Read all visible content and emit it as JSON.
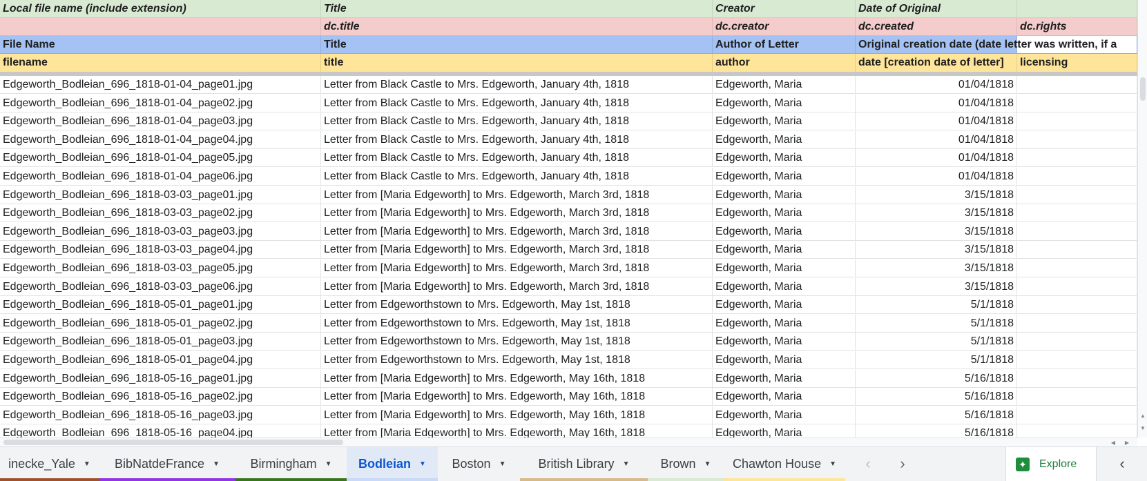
{
  "sheet": {
    "header_rows": {
      "label_row": [
        "Local file name (include extension)",
        "Title",
        "Creator",
        "Date of Original",
        ""
      ],
      "dc_row": [
        "",
        "dc.title",
        "dc.creator",
        "dc.created",
        "dc.rights"
      ],
      "display_row": [
        "File Name",
        "Title",
        "Author of Letter",
        "Original creation date (date letter was written, if a",
        ""
      ],
      "field_row": [
        "filename",
        "title",
        "author",
        "date [creation date of letter]",
        "licensing"
      ]
    },
    "rows": [
      [
        "Edgeworth_Bodleian_696_1818-01-04_page01.jpg",
        "Letter from Black Castle to Mrs. Edgeworth, January 4th, 1818",
        "Edgeworth, Maria",
        "01/04/1818",
        ""
      ],
      [
        "Edgeworth_Bodleian_696_1818-01-04_page02.jpg",
        "Letter from Black Castle to Mrs. Edgeworth, January 4th, 1818",
        "Edgeworth, Maria",
        "01/04/1818",
        ""
      ],
      [
        "Edgeworth_Bodleian_696_1818-01-04_page03.jpg",
        "Letter from Black Castle to Mrs. Edgeworth, January 4th, 1818",
        "Edgeworth, Maria",
        "01/04/1818",
        ""
      ],
      [
        "Edgeworth_Bodleian_696_1818-01-04_page04.jpg",
        "Letter from Black Castle to Mrs. Edgeworth, January 4th, 1818",
        "Edgeworth, Maria",
        "01/04/1818",
        ""
      ],
      [
        "Edgeworth_Bodleian_696_1818-01-04_page05.jpg",
        "Letter from Black Castle to Mrs. Edgeworth, January 4th, 1818",
        "Edgeworth, Maria",
        "01/04/1818",
        ""
      ],
      [
        "Edgeworth_Bodleian_696_1818-01-04_page06.jpg",
        "Letter from Black Castle to Mrs. Edgeworth, January 4th, 1818",
        "Edgeworth, Maria",
        "01/04/1818",
        ""
      ],
      [
        "Edgeworth_Bodleian_696_1818-03-03_page01.jpg",
        "Letter from [Maria Edgeworth] to Mrs. Edgeworth, March 3rd, 1818",
        "Edgeworth, Maria",
        "3/15/1818",
        ""
      ],
      [
        "Edgeworth_Bodleian_696_1818-03-03_page02.jpg",
        "Letter from [Maria Edgeworth] to Mrs. Edgeworth, March 3rd, 1818",
        "Edgeworth, Maria",
        "3/15/1818",
        ""
      ],
      [
        "Edgeworth_Bodleian_696_1818-03-03_page03.jpg",
        "Letter from [Maria Edgeworth] to Mrs. Edgeworth, March 3rd, 1818",
        "Edgeworth, Maria",
        "3/15/1818",
        ""
      ],
      [
        "Edgeworth_Bodleian_696_1818-03-03_page04.jpg",
        "Letter from [Maria Edgeworth] to Mrs. Edgeworth, March 3rd, 1818",
        "Edgeworth, Maria",
        "3/15/1818",
        ""
      ],
      [
        "Edgeworth_Bodleian_696_1818-03-03_page05.jpg",
        "Letter from [Maria Edgeworth] to Mrs. Edgeworth, March 3rd, 1818",
        "Edgeworth, Maria",
        "3/15/1818",
        ""
      ],
      [
        "Edgeworth_Bodleian_696_1818-03-03_page06.jpg",
        "Letter from [Maria Edgeworth] to Mrs. Edgeworth, March 3rd, 1818",
        "Edgeworth, Maria",
        "3/15/1818",
        ""
      ],
      [
        "Edgeworth_Bodleian_696_1818-05-01_page01.jpg",
        "Letter from Edgeworthstown to Mrs. Edgeworth, May 1st, 1818",
        "Edgeworth, Maria",
        "5/1/1818",
        ""
      ],
      [
        "Edgeworth_Bodleian_696_1818-05-01_page02.jpg",
        "Letter from Edgeworthstown to Mrs. Edgeworth, May 1st, 1818",
        "Edgeworth, Maria",
        "5/1/1818",
        ""
      ],
      [
        "Edgeworth_Bodleian_696_1818-05-01_page03.jpg",
        "Letter from Edgeworthstown to Mrs. Edgeworth, May 1st, 1818",
        "Edgeworth, Maria",
        "5/1/1818",
        ""
      ],
      [
        "Edgeworth_Bodleian_696_1818-05-01_page04.jpg",
        "Letter from Edgeworthstown to Mrs. Edgeworth, May 1st, 1818",
        "Edgeworth, Maria",
        "5/1/1818",
        ""
      ],
      [
        "Edgeworth_Bodleian_696_1818-05-16_page01.jpg",
        "Letter from [Maria Edgeworth] to Mrs. Edgeworth, May 16th, 1818",
        "Edgeworth, Maria",
        "5/16/1818",
        ""
      ],
      [
        "Edgeworth_Bodleian_696_1818-05-16_page02.jpg",
        "Letter from [Maria Edgeworth] to Mrs. Edgeworth, May 16th, 1818",
        "Edgeworth, Maria",
        "5/16/1818",
        ""
      ],
      [
        "Edgeworth_Bodleian_696_1818-05-16_page03.jpg",
        "Letter from [Maria Edgeworth] to Mrs. Edgeworth, May 16th, 1818",
        "Edgeworth, Maria",
        "5/16/1818",
        ""
      ],
      [
        "Edgeworth_Bodleian_696_1818-05-16_page04.jpg",
        "Letter from [Maria Edgeworth] to Mrs. Edgeworth, May 16th, 1818",
        "Edgeworth, Maria",
        "5/16/1818",
        ""
      ]
    ]
  },
  "tabs": [
    {
      "label": "inecke_Yale",
      "color": "#a0522d",
      "active": false
    },
    {
      "label": "BibNatdeFrance",
      "color": "#9334e6",
      "active": false
    },
    {
      "label": "Birmingham",
      "color": "#38761d",
      "active": false
    },
    {
      "label": "Bodleian",
      "color": "#c9daf8",
      "active": true
    },
    {
      "label": "Boston",
      "color": "",
      "active": false
    },
    {
      "label": "British Library",
      "color": "#d9b98a",
      "active": false
    },
    {
      "label": "Brown",
      "color": "#d9ead3",
      "active": false
    },
    {
      "label": "Chawton House",
      "color": "#ffe599",
      "active": false
    }
  ],
  "tab_icons": {
    "caret": "caret-down-icon",
    "prev": "chevron-left-icon",
    "next": "chevron-right-icon",
    "explore": "explore-icon",
    "side_panel": "chevron-left-icon"
  },
  "explore": {
    "label": "Explore"
  }
}
